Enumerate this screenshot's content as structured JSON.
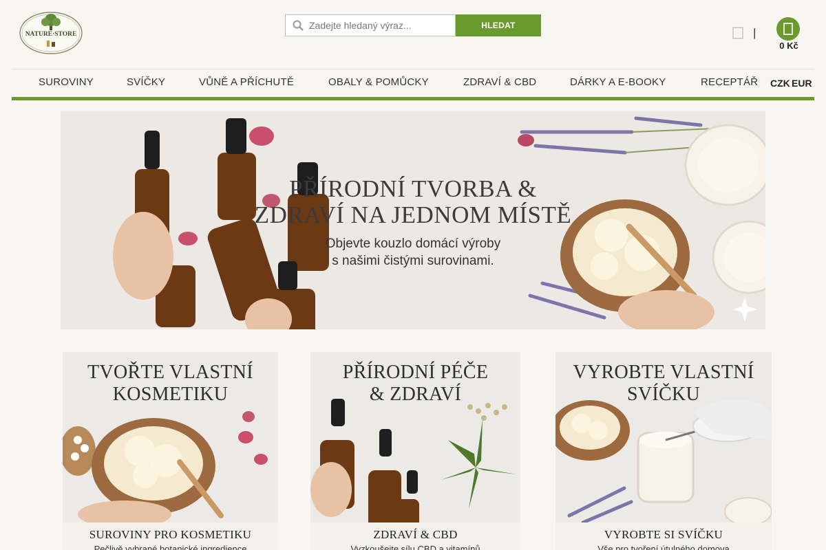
{
  "header": {
    "logo_text": "NATURE·STORE",
    "search": {
      "placeholder": "Zadejte hledaný výraz...",
      "button_label": "HLEDAT"
    },
    "separator": "|",
    "cart_amount": "0 Kč"
  },
  "nav": {
    "items": [
      "SUROVINY",
      "SVÍČKY",
      "VŮNĚ A PŘÍCHUTĚ",
      "OBALY & POMŮCKY",
      "ZDRAVÍ & CBD",
      "DÁRKY A E-BOOKY",
      "RECEPTÁŘ"
    ],
    "currency": [
      "CZK",
      "EUR"
    ]
  },
  "hero": {
    "title_line1": "PŘÍRODNÍ TVORBA &",
    "title_line2": "ZDRAVÍ NA JEDNOM MÍSTĚ",
    "subtitle_line1": "Objevte kouzlo domácí výroby",
    "subtitle_line2": "s našimi čistými surovinami."
  },
  "cards": [
    {
      "title_line1": "TVOŘTE VLASTNÍ",
      "title_line2": "KOSMETIKU",
      "foot_title": "SUROVINY PRO KOSMETIKU",
      "foot_desc": "Pečlivě vybrané botanické ingredience"
    },
    {
      "title_line1": "PŘÍRODNÍ PÉČE",
      "title_line2": "& ZDRAVÍ",
      "foot_title": "ZDRAVÍ & CBD",
      "foot_desc": "Vyzkoušejte sílu CBD a vitamínů"
    },
    {
      "title_line1": "VYROBTE VLASTNÍ",
      "title_line2": "SVÍČKU",
      "foot_title": "VYROBTE SI SVÍČKU",
      "foot_desc": "Vše pro tvoření útulného domova"
    }
  ],
  "colors": {
    "brand_green": "#6b9a2c",
    "background": "#f8f6f1"
  }
}
